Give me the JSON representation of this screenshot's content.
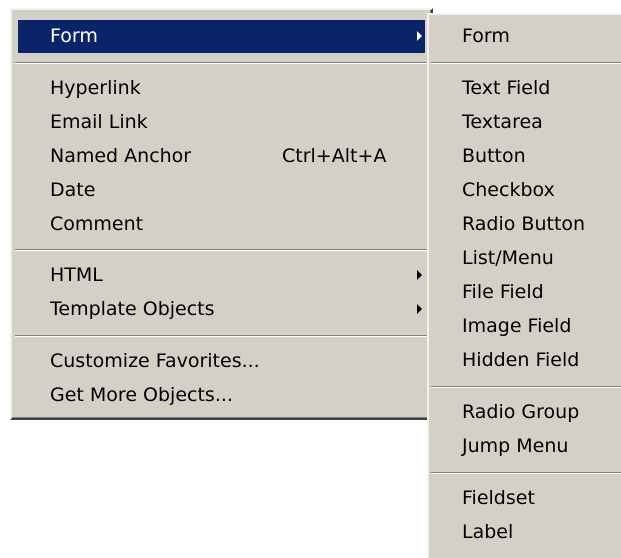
{
  "colors": {
    "menu_bg": "#d4d0c8",
    "highlight": "#0a246a",
    "highlight_text": "#ffffff"
  },
  "main_menu": {
    "form": "Form",
    "hyperlink": "Hyperlink",
    "email_link": "Email Link",
    "named_anchor": "Named Anchor",
    "named_anchor_shortcut": "Ctrl+Alt+A",
    "date": "Date",
    "comment": "Comment",
    "html": "HTML",
    "template_objects": "Template Objects",
    "customize_favorites": "Customize Favorites...",
    "get_more_objects": "Get More Objects..."
  },
  "form_submenu": {
    "form": "Form",
    "text_field": "Text Field",
    "textarea": "Textarea",
    "button": "Button",
    "checkbox": "Checkbox",
    "radio_button": "Radio Button",
    "list_menu": "List/Menu",
    "file_field": "File Field",
    "image_field": "Image Field",
    "hidden_field": "Hidden Field",
    "radio_group": "Radio Group",
    "jump_menu": "Jump Menu",
    "fieldset": "Fieldset",
    "label": "Label"
  }
}
